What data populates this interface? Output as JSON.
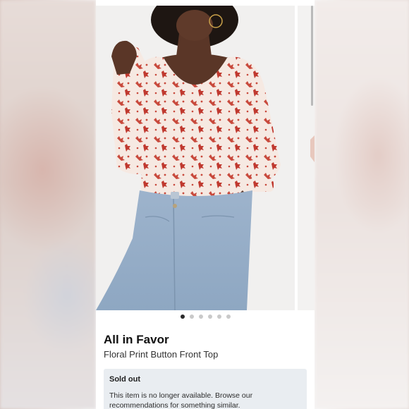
{
  "product": {
    "brand": "All in Favor",
    "name": "Floral Print Button Front Top"
  },
  "gallery": {
    "image_count": 6,
    "active_index": 0
  },
  "notice": {
    "title": "Sold out",
    "body": "This item is no longer available. Browse our recommendations for something similar."
  },
  "colors": {
    "accent_dot": "#2b2b2b",
    "notice_background": "#e9edf1",
    "print_red": "#c8493c"
  }
}
